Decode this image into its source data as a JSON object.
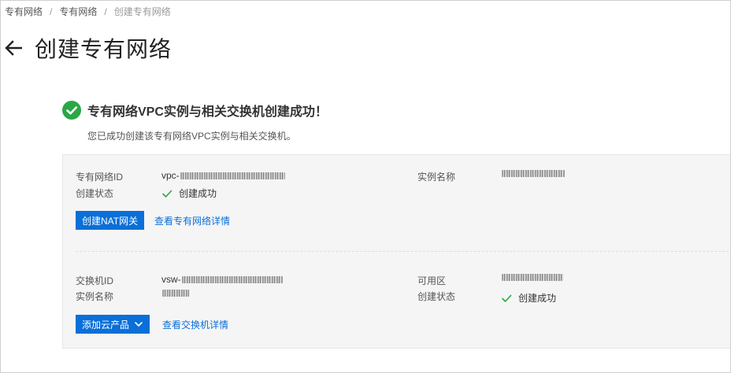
{
  "breadcrumb": {
    "items": [
      "专有网络",
      "专有网络"
    ],
    "separator": "/",
    "current": "创建专有网络"
  },
  "header": {
    "title": "创建专有网络",
    "back_icon": "arrow-left-icon"
  },
  "result": {
    "title": "专有网络VPC实例与相关交换机创建成功！",
    "description": "您已成功创建该专有网络VPC实例与相关交换机。",
    "icon": "success-check-circle-icon",
    "icon_color": "#2aa745"
  },
  "vpc": {
    "id_label": "专有网络ID",
    "id_prefix": "vpc-",
    "status_label": "创建状态",
    "status_value": "创建成功",
    "name_label": "实例名称",
    "create_nat_button": "创建NAT网关",
    "detail_link": "查看专有网络详情"
  },
  "vswitch": {
    "id_label": "交换机ID",
    "id_prefix": "vsw-",
    "name_label": "实例名称",
    "zone_label": "可用区",
    "status_label": "创建状态",
    "status_value": "创建成功",
    "add_product_button": "添加云产品",
    "detail_link": "查看交换机详情"
  },
  "colors": {
    "primary": "#0a6fd8",
    "success": "#2aa745",
    "panel_bg": "#f5f5f6"
  }
}
